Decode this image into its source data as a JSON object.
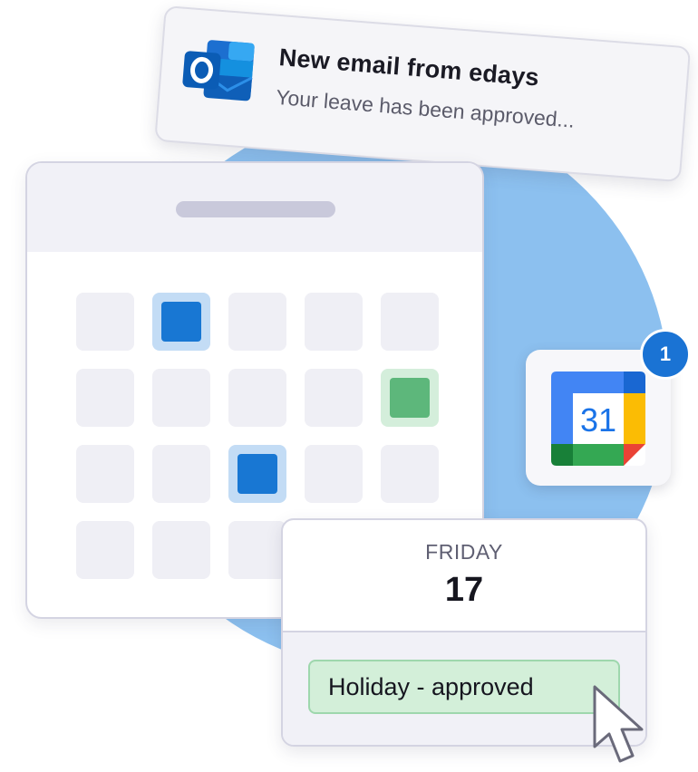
{
  "notification": {
    "title": "New email from edays",
    "body": "Your leave has been approved...",
    "icon": "outlook-icon"
  },
  "calendar": {
    "rows": [
      [
        "empty",
        "selected-blue",
        "empty",
        "empty",
        "empty"
      ],
      [
        "empty",
        "empty",
        "empty",
        "empty",
        "selected-green"
      ],
      [
        "empty",
        "empty",
        "selected-blue",
        "empty",
        "empty"
      ],
      [
        "empty",
        "empty",
        "empty",
        "empty",
        "empty"
      ]
    ],
    "colors": {
      "blue": "#1877d3",
      "green": "#5db77b",
      "empty": "#efeff5"
    }
  },
  "google_calendar": {
    "icon": "google-calendar-icon",
    "day": "31",
    "badge_count": "1"
  },
  "day_popup": {
    "weekday": "FRIDAY",
    "date": "17",
    "status": "Holiday - approved"
  },
  "colors": {
    "accent_blue": "#1a73d4",
    "circle": "#8cc0ef",
    "approved_bg": "#d3efd9"
  }
}
